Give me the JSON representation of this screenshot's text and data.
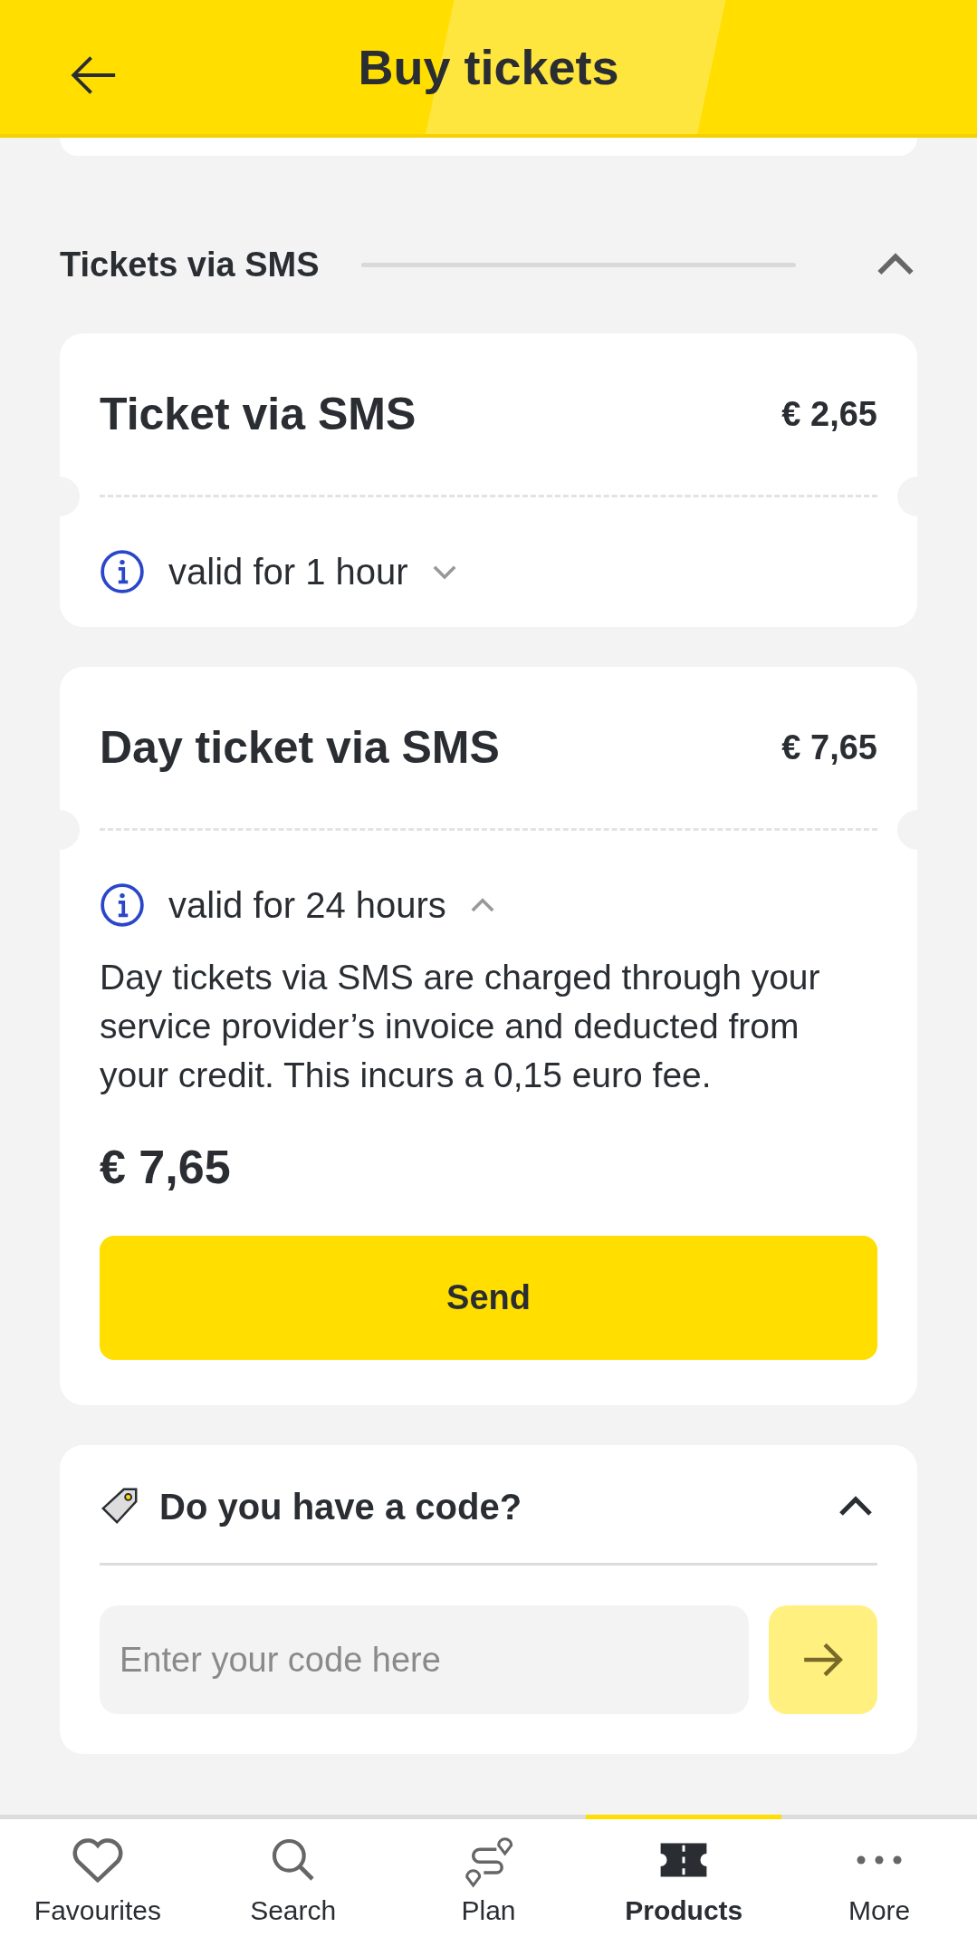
{
  "header": {
    "title": "Buy tickets"
  },
  "section": {
    "title": "Tickets via SMS",
    "expanded": true
  },
  "tickets": [
    {
      "name": "Ticket via SMS",
      "price": "€ 2,65",
      "validity": "valid for 1 hour",
      "expanded": false
    },
    {
      "name": "Day ticket via SMS",
      "price": "€ 7,65",
      "validity": "valid for 24 hours",
      "expanded": true,
      "description": "Day tickets via SMS are charged through your service provider’s invoice and deducted from your credit. This incurs a 0,15 euro fee.",
      "total": "€ 7,65",
      "button": "Send"
    }
  ],
  "code": {
    "title": "Do you have a code?",
    "expanded": true,
    "placeholder": "Enter your code here"
  },
  "nav": [
    {
      "label": "Favourites",
      "selected": false
    },
    {
      "label": "Search",
      "selected": false
    },
    {
      "label": "Plan",
      "selected": false
    },
    {
      "label": "Products",
      "selected": true
    },
    {
      "label": "More",
      "selected": false
    }
  ]
}
